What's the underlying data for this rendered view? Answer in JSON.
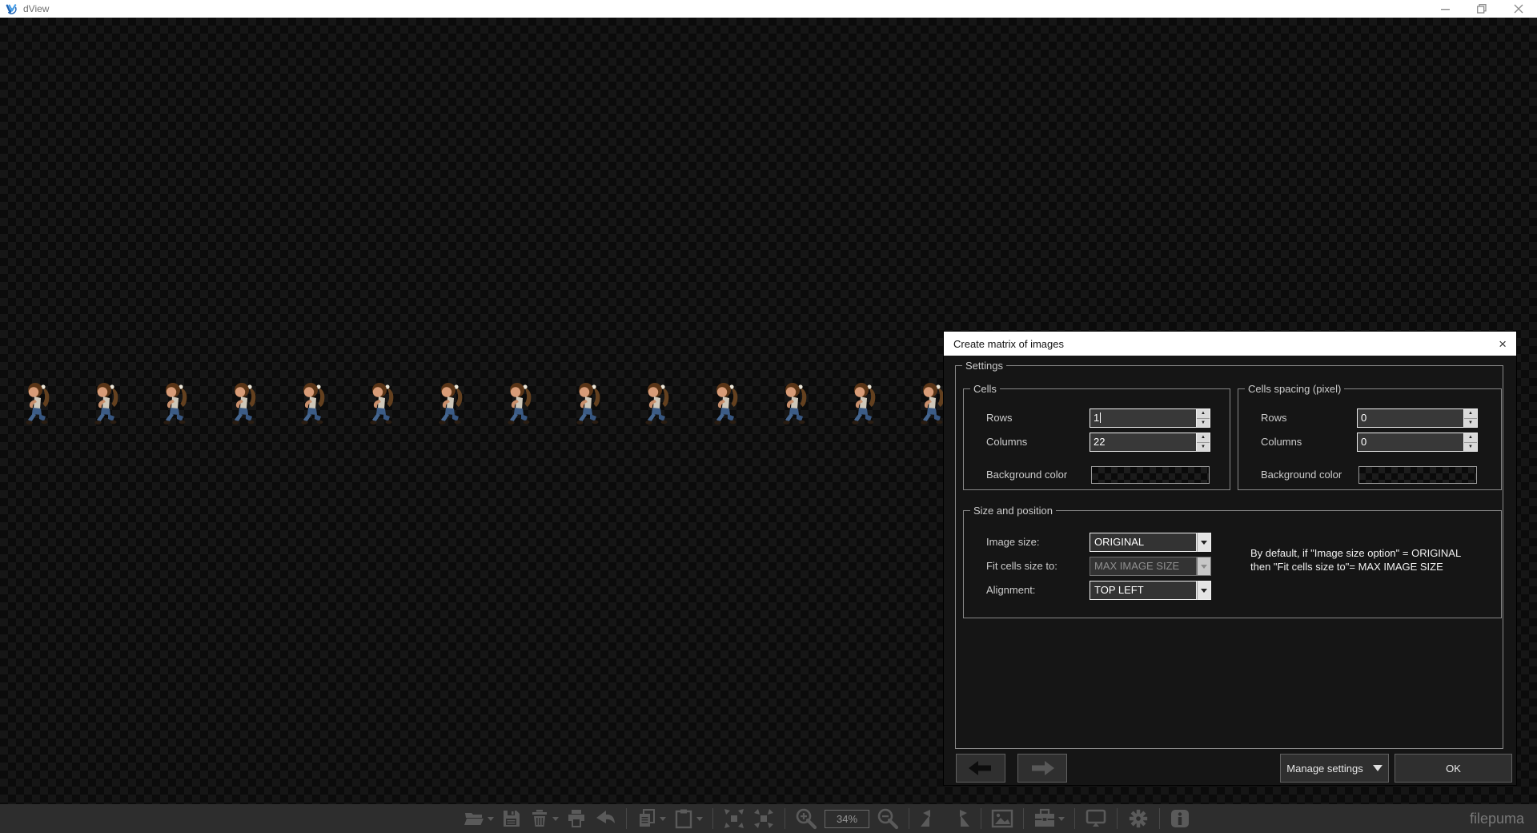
{
  "window": {
    "title": "dView"
  },
  "dialog": {
    "title": "Create matrix of images",
    "settings_label": "Settings",
    "cells": {
      "label": "Cells",
      "rows_label": "Rows",
      "rows_value": "1",
      "columns_label": "Columns",
      "columns_value": "22",
      "background_label": "Background color"
    },
    "spacing": {
      "label": "Cells spacing (pixel)",
      "rows_label": "Rows",
      "rows_value": "0",
      "columns_label": "Columns",
      "columns_value": "0",
      "background_label": "Background color"
    },
    "size_position": {
      "label": "Size and position",
      "image_size_label": "Image size:",
      "image_size_value": "ORIGINAL",
      "fit_cells_label": "Fit cells size to:",
      "fit_cells_value": "MAX IMAGE SIZE",
      "alignment_label": "Alignment:",
      "alignment_value": "TOP LEFT",
      "note_line1": "By default, if \"Image size option\" = ORIGINAL",
      "note_line2": "then \"Fit cells size to\"= MAX IMAGE SIZE"
    },
    "buttons": {
      "manage": "Manage settings",
      "ok": "OK"
    }
  },
  "toolbar": {
    "zoom_level": "34%",
    "icons": [
      "open-folder",
      "save",
      "delete",
      "print",
      "undo",
      "copy",
      "paste",
      "fit-to-screen",
      "actual-size",
      "zoom-in",
      "zoom-out",
      "rotate-left",
      "rotate-right",
      "image",
      "tools",
      "fullscreen",
      "settings",
      "info"
    ]
  },
  "glyphs": {
    "close": "×",
    "spin_up": "▲",
    "spin_down": "▼"
  },
  "watermark": "filepuma",
  "canvas": {
    "sprite_count": 14
  },
  "colors": {
    "accent_blue": "#2a7fd4",
    "toolbar_icon": "#5a5a5a",
    "dialog_bg": "#151515"
  }
}
